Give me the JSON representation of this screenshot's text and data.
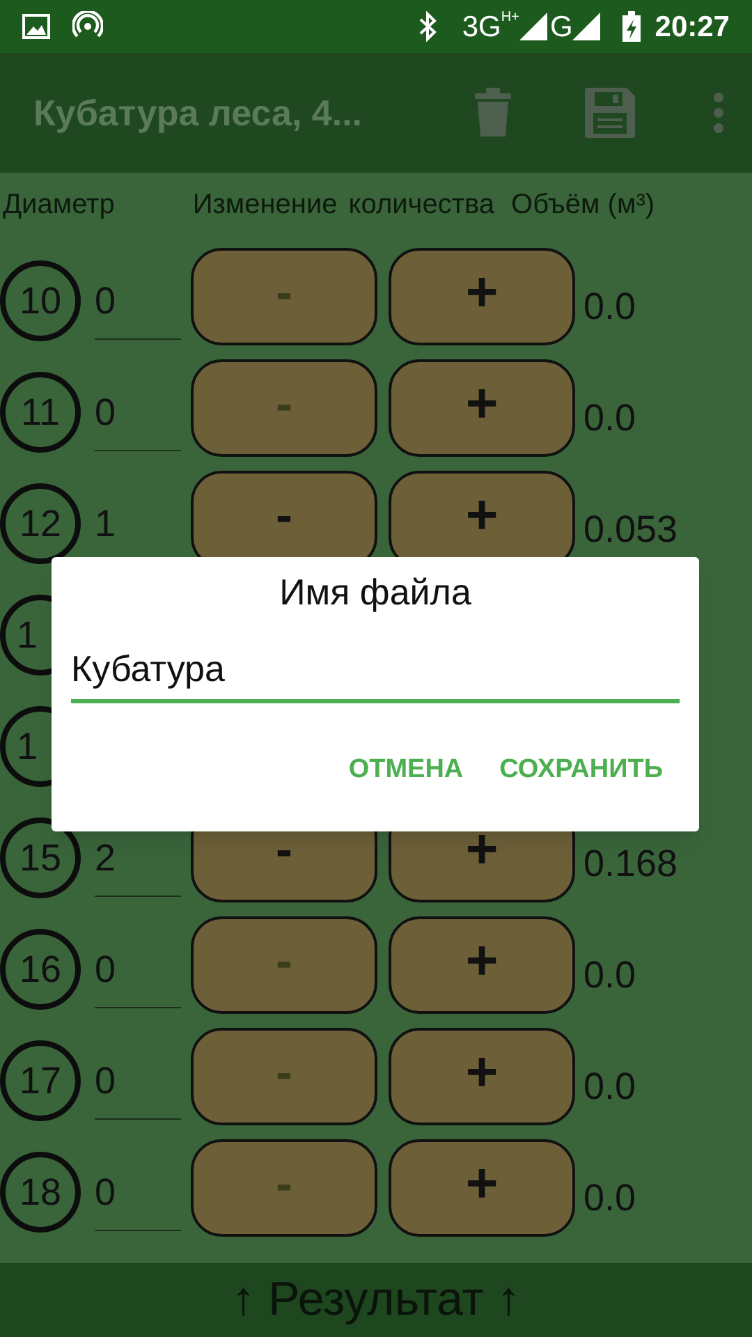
{
  "status_bar": {
    "network_1": "3G",
    "network_1_badge": "H+",
    "network_2": "G",
    "time": "20:27"
  },
  "toolbar": {
    "title": "Кубатура леса, 4..."
  },
  "columns": [
    "Диаметр",
    "Изменение",
    "количества",
    "Объём (м³)"
  ],
  "rows": [
    {
      "diameter": "10",
      "count": "0",
      "minus": "-",
      "minus_disabled": true,
      "plus": "+",
      "volume": "0.0"
    },
    {
      "diameter": "11",
      "count": "0",
      "minus": "-",
      "minus_disabled": true,
      "plus": "+",
      "volume": "0.0"
    },
    {
      "diameter": "12",
      "count": "1",
      "minus": "-",
      "minus_disabled": false,
      "plus": "+",
      "volume": "0.053"
    },
    {
      "diameter": "1"
    },
    {
      "diameter": "1"
    },
    {
      "diameter": "15",
      "count": "2",
      "minus": "-",
      "minus_disabled": false,
      "plus": "+",
      "volume": "0.168"
    },
    {
      "diameter": "16",
      "count": "0",
      "minus": "-",
      "minus_disabled": true,
      "plus": "+",
      "volume": "0.0"
    },
    {
      "diameter": "17",
      "count": "0",
      "minus": "-",
      "minus_disabled": true,
      "plus": "+",
      "volume": "0.0"
    },
    {
      "diameter": "18",
      "count": "0",
      "minus": "-",
      "minus_disabled": true,
      "plus": "+",
      "volume": "0.0"
    }
  ],
  "result_bar": "↑ Результат ↑",
  "dialog": {
    "title": "Имя файла",
    "value": "Кубатура",
    "buttons": [
      "ОТМЕНА",
      "СОХРАНИТЬ"
    ]
  }
}
